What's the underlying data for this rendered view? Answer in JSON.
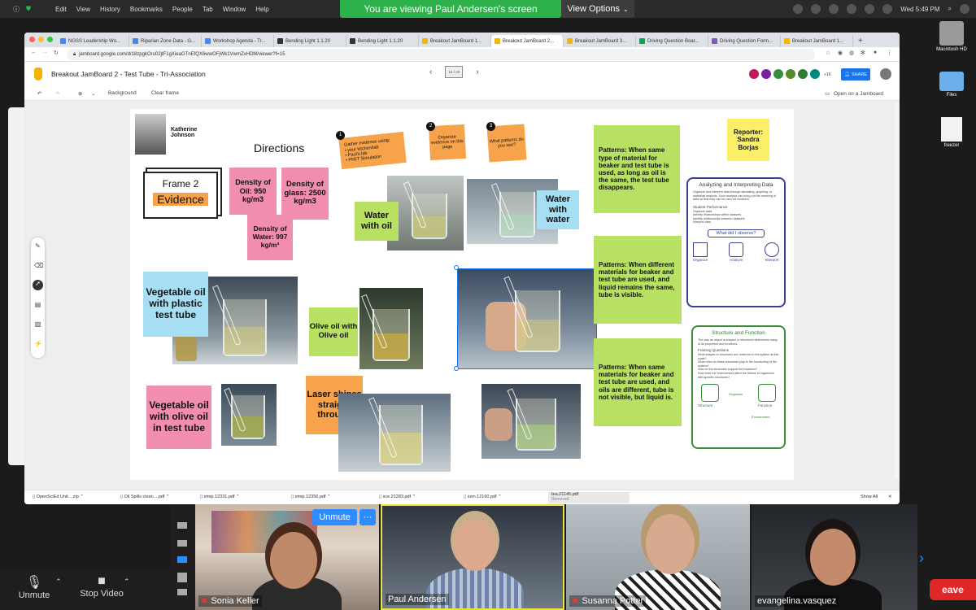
{
  "menubar": {
    "items": [
      "Edit",
      "View",
      "History",
      "Bookmarks",
      "People",
      "Tab",
      "Window",
      "Help"
    ],
    "clock": "Wed 5:49 PM"
  },
  "share_banner": "You are viewing Paul Andersen's screen",
  "view_options": "View Options",
  "desktop": {
    "icons": [
      "Macintosh HD",
      "Files",
      "freezer"
    ]
  },
  "browser": {
    "tabs": [
      "NGSS Leadership Wo...",
      "Riparian Zone Data - G...",
      "Workshop Agenda - Tr...",
      "Bending Light 1.1.20",
      "Bending Light 1.1.20",
      "Breakout JamBoard 1...",
      "Breakout JamBoard 2...",
      "Breakout JamBoard 3...",
      "Driving Question Boar...",
      "Driving Question Form...",
      "Breakout JamBoard 1..."
    ],
    "url": "jamboard.google.com/d/18zpgkOru02jtF1gXieaGTnEfQX6wwOFjWk1VwmZxHDM/viewer?f=15"
  },
  "jamboard": {
    "title": "Breakout JamBoard 2 - Test Tube - Tri-Association",
    "frame_label": "16 / 20",
    "avatar_more": "+16",
    "share": "SHARE",
    "toolbar": {
      "background": "Background",
      "clear": "Clear frame",
      "open": "Open on a Jamboard"
    }
  },
  "board": {
    "katherine": "Katherine Johnson",
    "directions": "Directions",
    "frame_title": "Frame 2",
    "frame_sub": "Evidence",
    "steps": [
      {
        "num": "1",
        "text": "Gather evidence using:\n• your kitchen/lab\n• Paul's lab\n• PhET Simulation"
      },
      {
        "num": "2",
        "text": "Organize evidence on this page"
      },
      {
        "num": "3",
        "text": "What patterns do you see?"
      }
    ],
    "notes": {
      "oil": "Density of Oil: 950 kg/m3",
      "glass": "Density of glass: 2500 kg/m3",
      "water": "Density of Water: 997 kg/m³",
      "water_oil": "Water with oil",
      "water_water": "Water with water",
      "veg_plastic": "Vegetable oil with plastic test tube",
      "olive_olive": "Olive oil with Olive oil",
      "veg_olive": "Vegetable oil with olive oil in test tube",
      "laser": "Laser shines straight through",
      "pattern1": "Patterns: When same type of material for beaker and test tube is used, as long as oil is the same, the test tube disappears.",
      "pattern2": "Patterns: When different materials for beaker and test tube are used, and liquid remains the same, tube is visible.",
      "pattern3": "Patterns: When same materials for beaker and test tube are used, and oils are different, tube is not visible, but liquid is.",
      "reporter": "Reporter: Sandra Borjas"
    },
    "card1": {
      "title": "Analyzing and Interpreting Data",
      "body": "Organize and interpret data through tabulating, graphing, or statistical analysis. Such analysis can bring out the meaning of data so that they can be used as evidence.",
      "perf_title": "Student Performance",
      "items": [
        "Organize data",
        "Identify relationships within datasets",
        "Identify relationships between datasets",
        "Interpret data"
      ],
      "question": "What did I observe?",
      "steps": [
        "Organize",
        "Analyze",
        "Interpret"
      ]
    },
    "card2": {
      "title": "Structure and Function",
      "body": "The way an object is shaped or structured determines many of its properties and functions.",
      "framing": "Framing Questions",
      "questions": [
        "What shapes or structures are observed in the system at this scale?",
        "What roles do these structures play in the functioning of the system?",
        "How do the structures support the functions?",
        "How does the environment affect the fitness of organisms with specific structures?"
      ],
      "labels": [
        "Structure",
        "Function",
        "Organism",
        "Environment"
      ]
    }
  },
  "downloads": [
    "OpenSciEd Unit....zip",
    "Oil Spills clean....pdf",
    "emip.12331.pdf",
    "emip.12356.pdf",
    "sce.21283.pdf",
    "ssm.12160.pdf",
    "tea.21145.pdf"
  ],
  "download_removed": "Removed",
  "show_all": "Show All",
  "zoom": {
    "unmute_label": "Unmute",
    "video_label": "Stop Video",
    "unmute_button": "Unmute",
    "leave": "eave",
    "participants": [
      "Sonia Keller",
      "Paul Andersen",
      "Susanna Potter",
      "evangelina.vasquez"
    ]
  }
}
